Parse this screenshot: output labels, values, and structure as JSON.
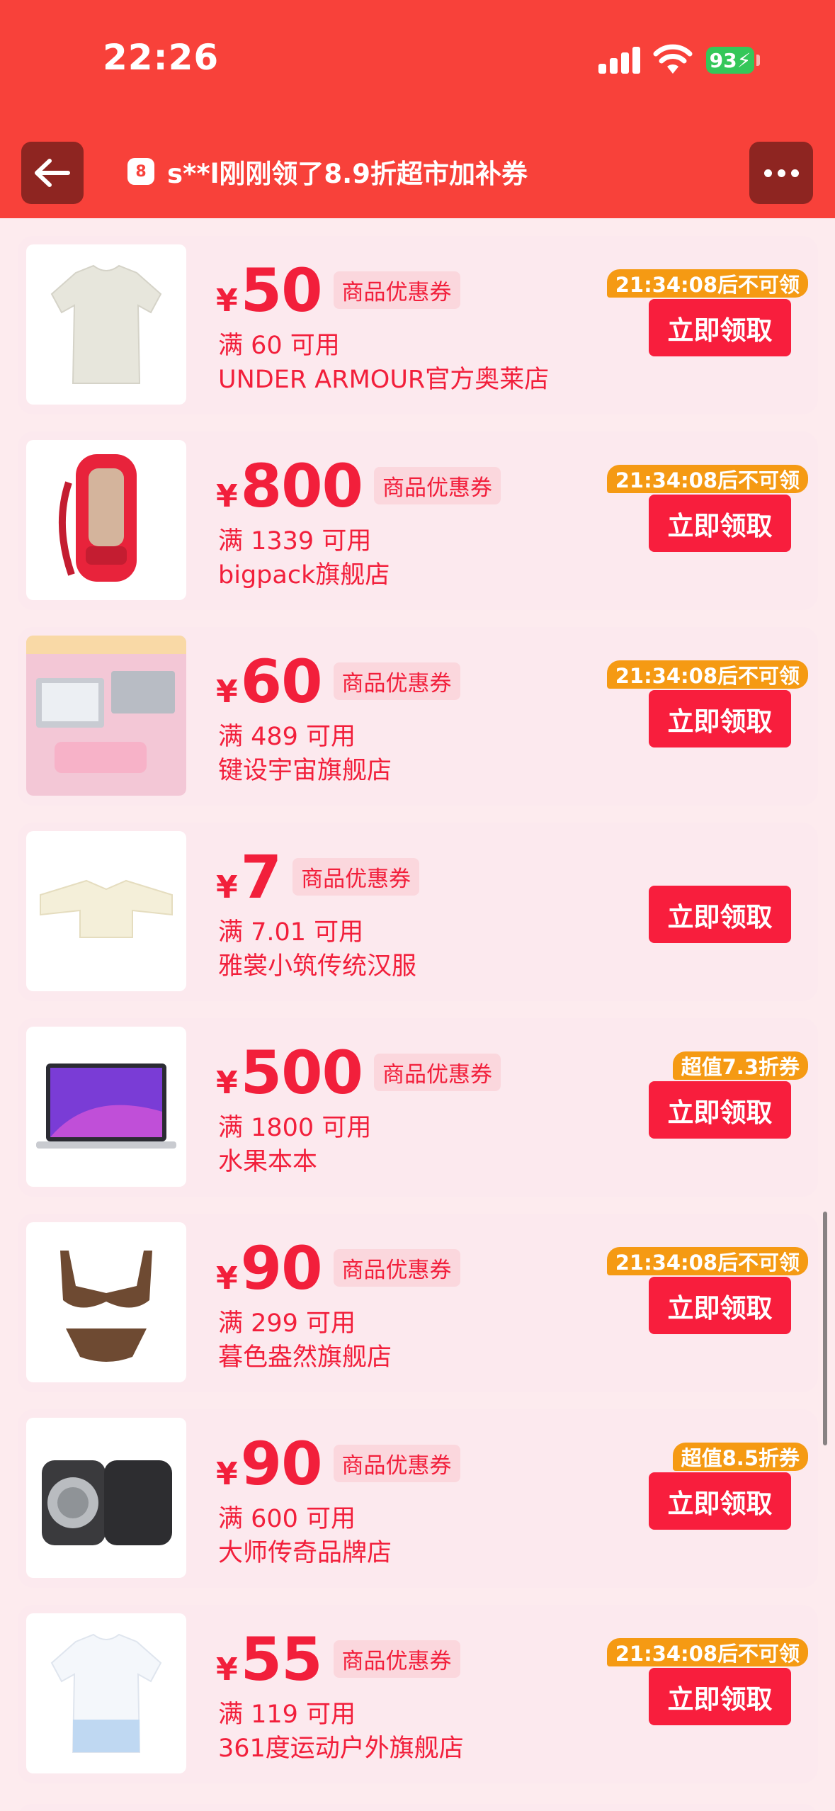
{
  "status_bar": {
    "time": "22:26",
    "battery": "93"
  },
  "header": {
    "notice_icon": "8",
    "notice": "s**l刚刚领了8.9折超市加补券"
  },
  "coupons": [
    {
      "amount": "50",
      "tag": "商品优惠券",
      "condition": "满 60 可用",
      "shop": "UNDER ARMOUR官方奥莱店",
      "badge": "21:34:08后不可领",
      "button": "立即领取"
    },
    {
      "amount": "800",
      "tag": "商品优惠券",
      "condition": "满 1339 可用",
      "shop": "bigpack旗舰店",
      "badge": "21:34:08后不可领",
      "button": "立即领取"
    },
    {
      "amount": "60",
      "tag": "商品优惠券",
      "condition": "满 489 可用",
      "shop": "键设宇宙旗舰店",
      "badge": "21:34:08后不可领",
      "button": "立即领取"
    },
    {
      "amount": "7",
      "tag": "商品优惠券",
      "condition": "满 7.01 可用",
      "shop": "雅裳小筑传统汉服",
      "badge": "",
      "button": "立即领取"
    },
    {
      "amount": "500",
      "tag": "商品优惠券",
      "condition": "满 1800 可用",
      "shop": "水果本本",
      "badge": "超值7.3折券",
      "button": "立即领取"
    },
    {
      "amount": "90",
      "tag": "商品优惠券",
      "condition": "满 299 可用",
      "shop": "暮色盎然旗舰店",
      "badge": "21:34:08后不可领",
      "button": "立即领取"
    },
    {
      "amount": "90",
      "tag": "商品优惠券",
      "condition": "满 600 可用",
      "shop": "大师传奇品牌店",
      "badge": "超值8.5折券",
      "button": "立即领取"
    },
    {
      "amount": "55",
      "tag": "商品优惠券",
      "condition": "满 119 可用",
      "shop": "361度运动户外旗舰店",
      "badge": "21:34:08后不可领",
      "button": "立即领取"
    }
  ],
  "currency_symbol": "¥",
  "colors": {
    "header": "#f8413a",
    "accent": "#f21f3b",
    "badge": "#f59a13",
    "card": "#fce9ee"
  }
}
